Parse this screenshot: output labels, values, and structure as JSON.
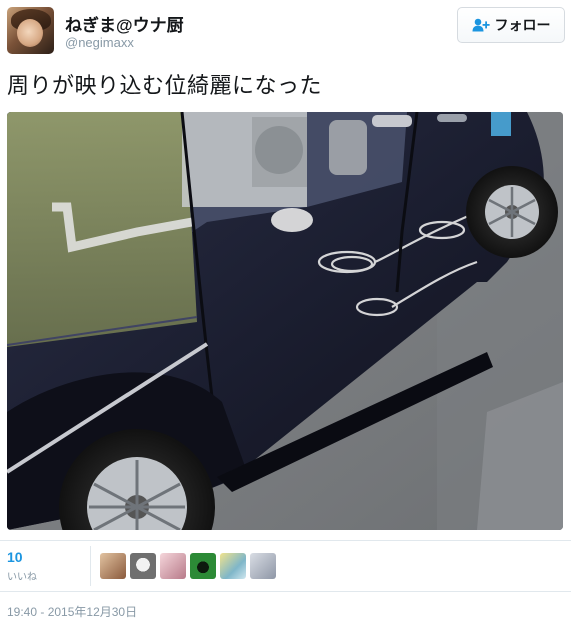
{
  "user": {
    "display_name": "ねぎま@ウナ厨",
    "screen_name": "@negimaxx",
    "avatar_icon": "user-avatar-photo"
  },
  "follow_button": {
    "label": "フォロー",
    "icon": "add-user-icon"
  },
  "tweet": {
    "text": "周りが映り込む位綺麗になった",
    "photo_icon": "car-photo"
  },
  "stats": {
    "likes_count": "10",
    "likes_label": "いいね",
    "likers": [
      {
        "icon": "liker-avatar-1",
        "color": "#c9a27a"
      },
      {
        "icon": "liker-avatar-2",
        "color": "#6f6f6f"
      },
      {
        "icon": "liker-avatar-3",
        "color": "#e8b7c4"
      },
      {
        "icon": "liker-avatar-4",
        "color": "#1d5a24"
      },
      {
        "icon": "liker-avatar-5",
        "color": "#9ac7d8"
      },
      {
        "icon": "liker-avatar-6",
        "color": "#b7bec9"
      }
    ]
  },
  "timestamp": "19:40 - 2015年12月30日",
  "colors": {
    "accent": "#1b95e0",
    "muted": "#8899a6",
    "text": "#14171a",
    "border": "#e1e8ed"
  }
}
